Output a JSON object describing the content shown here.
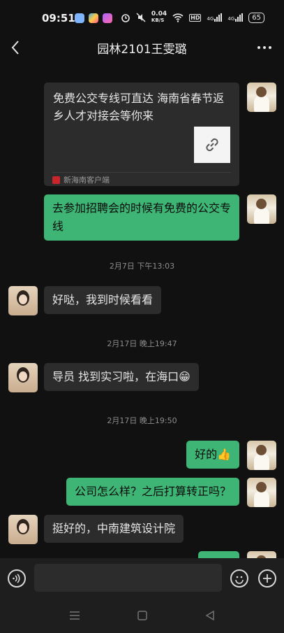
{
  "status_bar": {
    "time": "09:51",
    "speed_value": "0.04",
    "speed_unit": "KB/S",
    "hd_label": "HD",
    "network_label_1": "4G",
    "network_label_2": "4G",
    "battery": "65"
  },
  "header": {
    "title": "园林2101王雯璐"
  },
  "messages": {
    "link_card": {
      "title": "免费公交专线可直达 海南省春节返乡人才对接会等你来",
      "source": "新海南客户端"
    },
    "msg1": "去参加招聘会的时候有免费的公交专线",
    "sep1": "2月7日 下午13:03",
    "msg2": "好哒，我到时候看看",
    "sep2": "2月17日 晚上19:47",
    "msg3": "导员 找到实习啦，在海口😁",
    "sep3": "2月17日 晚上19:50",
    "msg4": "好的👍",
    "msg5": "公司怎么样？之后打算转正吗？",
    "msg6": "挺好的，中南建筑设计院"
  },
  "colors": {
    "background": "#111111",
    "sent_bubble": "#3eb575",
    "received_bubble": "#2c2c2c"
  }
}
